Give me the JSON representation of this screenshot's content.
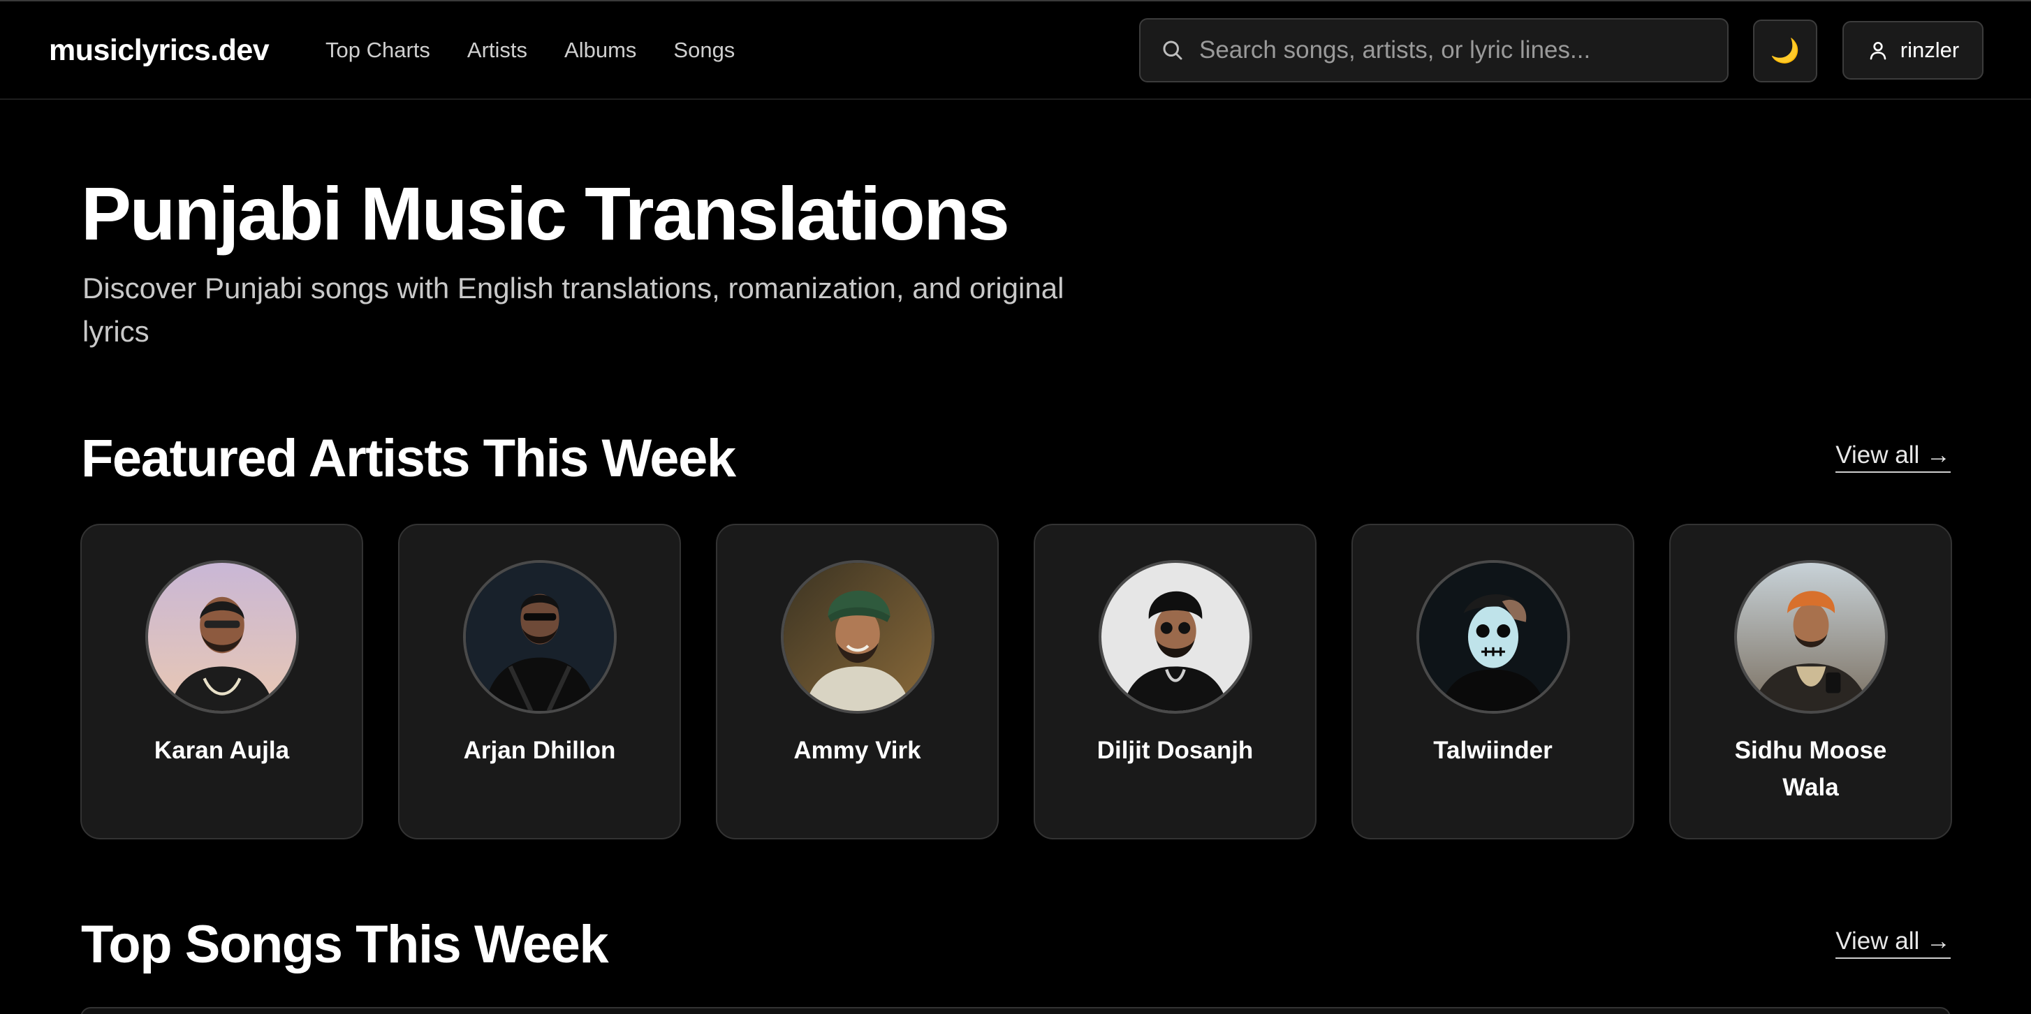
{
  "header": {
    "logo": "musiclyrics.dev",
    "nav": [
      {
        "label": "Top Charts"
      },
      {
        "label": "Artists"
      },
      {
        "label": "Albums"
      },
      {
        "label": "Songs"
      }
    ],
    "search_placeholder": "Search songs, artists, or lyric lines...",
    "theme_toggle_icon": "moon-icon",
    "user_label": "rinzler"
  },
  "hero": {
    "title": "Punjabi Music Translations",
    "subtitle": "Discover Punjabi songs with English translations, romanization, and original lyrics"
  },
  "featured": {
    "title": "Featured Artists This Week",
    "view_all": "View all →",
    "artists": [
      {
        "name": "Karan Aujla"
      },
      {
        "name": "Arjan Dhillon"
      },
      {
        "name": "Ammy Virk"
      },
      {
        "name": "Diljit Dosanjh"
      },
      {
        "name": "Talwiinder"
      },
      {
        "name": "Sidhu Moose Wala"
      }
    ]
  },
  "top_songs": {
    "title": "Top Songs This Week",
    "view_all": "View all →"
  },
  "colors": {
    "background": "#000000",
    "card": "#1a1a1a",
    "border": "#333333",
    "muted_text": "#c9c9c9"
  }
}
